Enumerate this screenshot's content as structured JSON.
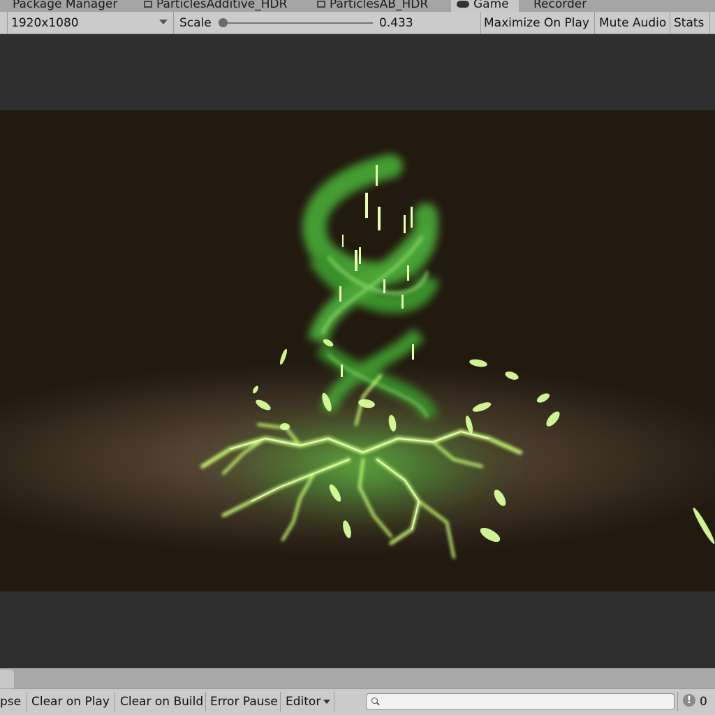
{
  "tabs": [
    {
      "label": "Package Manager",
      "icon": "none"
    },
    {
      "label": "ParticlesAdditive_HDR",
      "icon": "scene-icon"
    },
    {
      "label": "ParticlesAB_HDR",
      "icon": "scene-icon"
    },
    {
      "label": "Game",
      "icon": "gamepad-icon",
      "active": true
    },
    {
      "label": "Recorder",
      "icon": "none"
    }
  ],
  "toolbar": {
    "resolution": "1920x1080",
    "scale_label": "Scale",
    "scale_value": "0.433",
    "maximize_label": "Maximize On Play",
    "mute_label": "Mute Audio",
    "stats_label": "Stats"
  },
  "scene": {
    "effect": "green nature vortex particle effect with ground lightning cracks and leaves",
    "colors": {
      "glow": "#b8ff6a",
      "green": "#4cc83c",
      "background": "#3a2d20"
    }
  },
  "console": {
    "collapse_label": "pse",
    "clear_on_play_label": "Clear on Play",
    "clear_on_build_label": "Clear on Build",
    "error_pause_label": "Error Pause",
    "editor_label": "Editor",
    "search_placeholder": "",
    "warning_icon": "!",
    "warning_count": "0"
  }
}
